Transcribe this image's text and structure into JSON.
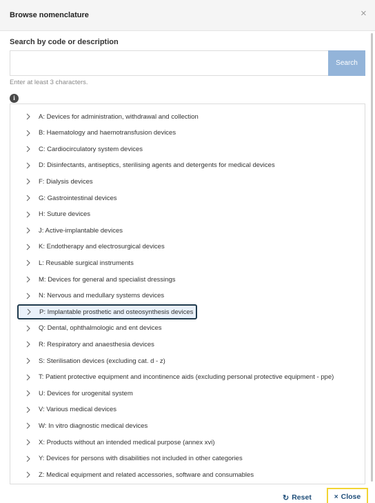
{
  "dialog": {
    "title": "Browse nomenclature",
    "close_glyph": "×"
  },
  "search": {
    "label": "Search by code or description",
    "value": "",
    "placeholder": "",
    "button_label": "Search",
    "hint": "Enter at least 3 characters."
  },
  "info_icon": "i",
  "tree": {
    "selected_index": 12,
    "items": [
      {
        "label": "A: Devices for administration, withdrawal and collection"
      },
      {
        "label": "B: Haematology and haemotransfusion devices"
      },
      {
        "label": "C: Cardiocirculatory system devices"
      },
      {
        "label": "D: Disinfectants, antiseptics, sterilising agents and detergents for medical devices"
      },
      {
        "label": "F: Dialysis devices"
      },
      {
        "label": "G: Gastrointestinal devices"
      },
      {
        "label": "H: Suture devices"
      },
      {
        "label": "J: Active-implantable devices"
      },
      {
        "label": "K: Endotherapy and electrosurgical devices"
      },
      {
        "label": "L: Reusable surgical instruments"
      },
      {
        "label": "M: Devices for general and specialist dressings"
      },
      {
        "label": "N: Nervous and medullary systems devices"
      },
      {
        "label": "P: Implantable prosthetic and osteosynthesis devices"
      },
      {
        "label": "Q: Dental, ophthalmologic and ent devices"
      },
      {
        "label": "R: Respiratory and anaesthesia devices"
      },
      {
        "label": "S: Sterilisation devices (excluding cat. d - z)"
      },
      {
        "label": "T: Patient protective equipment and incontinence aids (excluding personal protective equipment - ppe)"
      },
      {
        "label": "U: Devices for urogenital system"
      },
      {
        "label": "V: Various medical devices"
      },
      {
        "label": "W: In vitro diagnostic medical devices"
      },
      {
        "label": "X: Products without an intended medical purpose (annex xvi)"
      },
      {
        "label": "Y: Devices for persons with disabilities not included in other categories"
      },
      {
        "label": "Z: Medical equipment and related accessories, software and consumables"
      }
    ]
  },
  "footer": {
    "reset_icon": "↻",
    "reset_label": "Reset",
    "close_icon": "×",
    "close_label": "Close"
  },
  "colors": {
    "search_button": "#93b4d9",
    "selected_border": "#1f3a4d",
    "selected_bg": "#e9f1fa",
    "footer_text": "#1f4e79",
    "close_focus": "#f2d433"
  }
}
